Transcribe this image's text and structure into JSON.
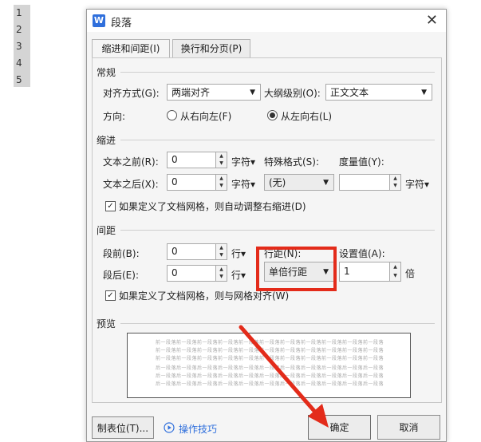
{
  "doc_gutter": {
    "line_numbers": [
      "1",
      "2",
      "3",
      "4",
      "5"
    ]
  },
  "dialog": {
    "title": "段落",
    "app_icon": "W",
    "close": "✕",
    "tabs": [
      "缩进和间距(I)",
      "换行和分页(P)"
    ],
    "general": {
      "section": "常规",
      "align_label": "对齐方式(G):",
      "align_value": "两端对齐",
      "outline_label": "大纲级别(O):",
      "outline_value": "正文文本",
      "direction_label": "方向:",
      "rtl": "从右向左(F)",
      "ltr": "从左向右(L)",
      "direction_selected": "ltr"
    },
    "indent": {
      "section": "缩进",
      "before_label": "文本之前(R):",
      "before_value": "0",
      "before_unit": "字符▾",
      "after_label": "文本之后(X):",
      "after_value": "0",
      "after_unit": "字符▾",
      "special_label": "特殊格式(S):",
      "special_value": "(无)",
      "measure_label": "度量值(Y):",
      "measure_value": "",
      "measure_unit": "字符▾",
      "grid_check": "如果定义了文档网格，则自动调整右缩进(D)",
      "grid_checked": true
    },
    "spacing": {
      "section": "间距",
      "before_label": "段前(B):",
      "before_value": "0",
      "before_unit": "行▾",
      "after_label": "段后(E):",
      "after_value": "0",
      "after_unit": "行▾",
      "line_label": "行距(N):",
      "line_value": "单倍行距",
      "setting_label": "设置值(A):",
      "setting_value": "1",
      "setting_unit": "倍",
      "grid_check": "如果定义了文档网格，则与网格对齐(W)",
      "grid_checked": true
    },
    "preview": {
      "section": "预览",
      "prev_text": "前一段落前一段落前一段落前一段落前一段落前一段落前一段落前一段落前一段落前一段落前一段落",
      "next_text": "后一段落后一段落后一段落后一段落后一段落后一段落后一段落后一段落后一段落后一段落后一段落"
    },
    "buttons": {
      "tabs": "制表位(T)...",
      "tips": "操作技巧",
      "ok": "确定",
      "cancel": "取消"
    }
  },
  "colors": {
    "highlight": "#e32b1a",
    "accent": "#2f6fdc"
  }
}
